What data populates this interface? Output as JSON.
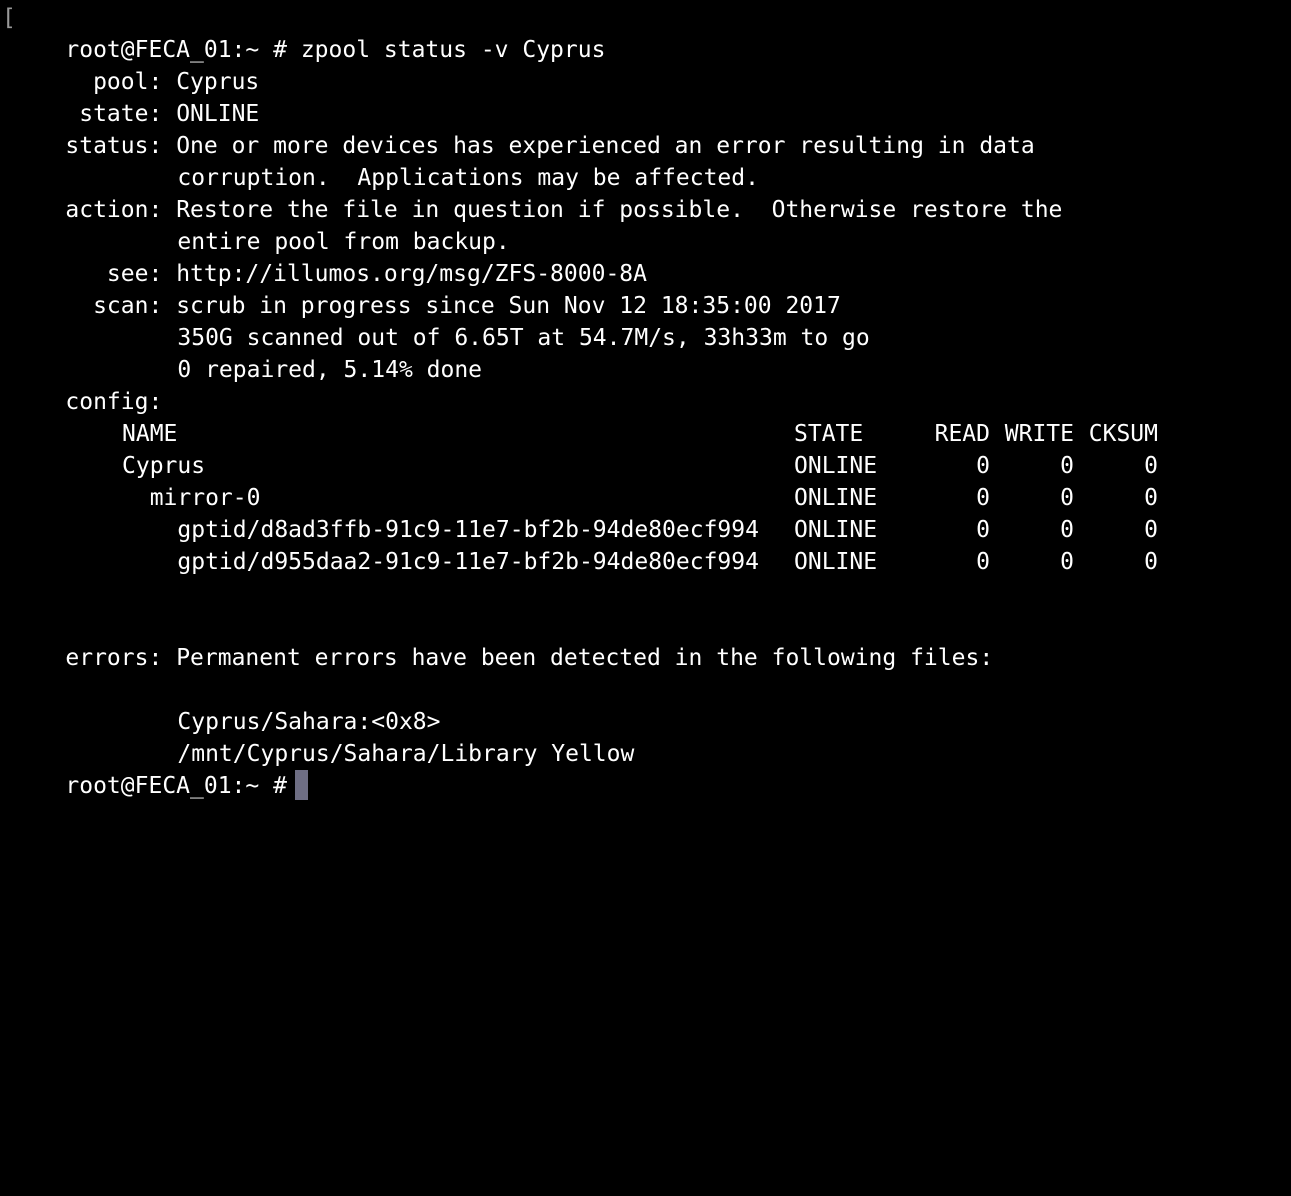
{
  "colors": {
    "background": "#000000",
    "text": "#ffffff",
    "cursor": "#6e6e84"
  },
  "prompt": "root@FECA_01:~ #",
  "command": "zpool status -v Cyprus",
  "status_fields": {
    "pool_label": "  pool:",
    "pool_value": "Cyprus",
    "state_label": " state:",
    "state_value": "ONLINE",
    "status_label": "status:",
    "status_line1": "One or more devices has experienced an error resulting in data",
    "status_line2": "corruption.  Applications may be affected.",
    "action_label": "action:",
    "action_line1": "Restore the file in question if possible.  Otherwise restore the",
    "action_line2": "entire pool from backup.",
    "see_label": "   see:",
    "see_value": "http://illumos.org/msg/ZFS-8000-8A",
    "scan_label": "  scan:",
    "scan_line1": "scrub in progress since Sun Nov 12 18:35:00 2017",
    "scan_line2": "350G scanned out of 6.65T at 54.7M/s, 33h33m to go",
    "scan_line3": "0 repaired, 5.14% done",
    "config_label": "config:"
  },
  "config_table": {
    "headers": {
      "name": "NAME",
      "state": "STATE",
      "read": "READ",
      "write": "WRITE",
      "cksum": "CKSUM"
    },
    "rows": [
      {
        "name": "Cyprus",
        "state": "ONLINE",
        "read": "0",
        "write": "0",
        "cksum": "0"
      },
      {
        "name": "  mirror-0",
        "state": "ONLINE",
        "read": "0",
        "write": "0",
        "cksum": "0"
      },
      {
        "name": "    gptid/d8ad3ffb-91c9-11e7-bf2b-94de80ecf994",
        "state": "ONLINE",
        "read": "0",
        "write": "0",
        "cksum": "0"
      },
      {
        "name": "    gptid/d955daa2-91c9-11e7-bf2b-94de80ecf994",
        "state": "ONLINE",
        "read": "0",
        "write": "0",
        "cksum": "0"
      }
    ]
  },
  "errors": {
    "label": "errors:",
    "message": "Permanent errors have been detected in the following files:",
    "files": [
      "Cyprus/Sahara:<0x8>",
      "/mnt/Cyprus/Sahara/Library Yellow"
    ]
  }
}
